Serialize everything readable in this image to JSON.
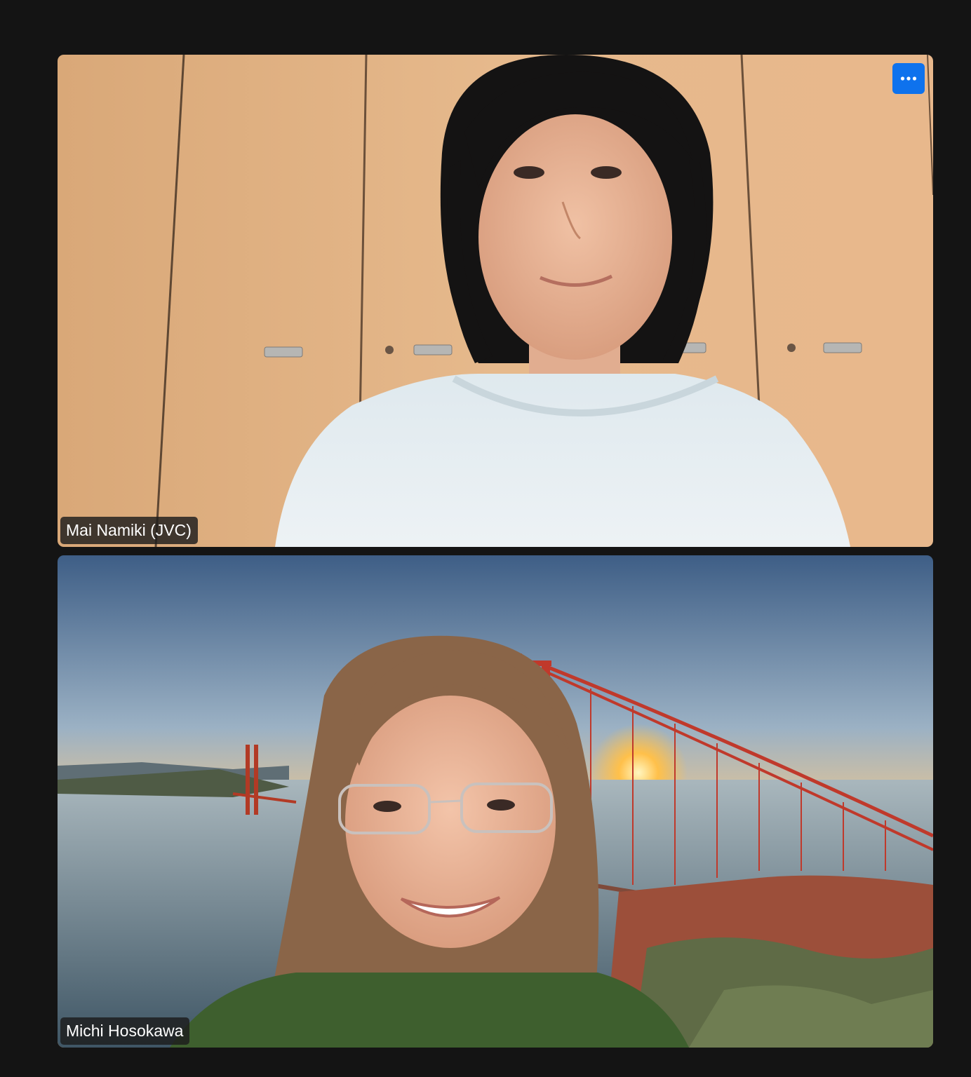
{
  "participants": [
    {
      "name": "Mai Namiki (JVC)",
      "background": "wooden cabinets",
      "more_options_icon": "ellipsis-icon"
    },
    {
      "name": "Michi Hosokawa",
      "background": "Golden Gate Bridge at sunset (virtual background)"
    }
  ],
  "colors": {
    "window_background": "#141414",
    "accent": "#0e72ed",
    "label_background": "#1c1c1c",
    "label_text": "#ffffff"
  }
}
